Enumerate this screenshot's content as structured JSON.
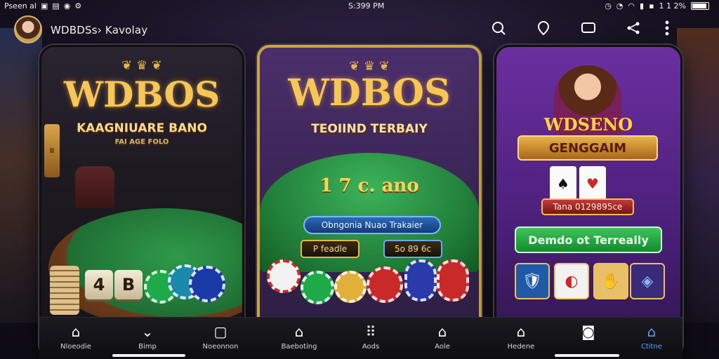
{
  "status_bar": {
    "left_text": "Pseen al",
    "time": "S:399 PM",
    "battery": "1 1 2%"
  },
  "app_bar": {
    "title": "WDBDSs› Kavolay"
  },
  "phone_1": {
    "brand": "WDBOS",
    "tagline": "KAAGNIUARE BANO",
    "subtag": "FAI AGE FOLO",
    "dice": [
      "4",
      "B"
    ]
  },
  "phone_2": {
    "brand": "WDBOS",
    "tagline": "TEOIIND TERBAIY",
    "odds": "1 7 c. ano",
    "banner": "Obngonia Nuao Trakaier",
    "pill_left": "P feadle",
    "pill_right": "5o 89 6c"
  },
  "phone_3": {
    "brand": "WDSENO",
    "banner": "GENGGAIM",
    "promo": "Tana 0129895ce",
    "cta": "Demdo ot Terreally"
  },
  "nav": {
    "items": [
      {
        "label": "Nloeodie",
        "icon": "home-icon"
      },
      {
        "label": "Bimp",
        "icon": "chevron-down-icon"
      },
      {
        "label": "Noeonnon",
        "icon": "frame-icon"
      },
      {
        "label": "Baeboting",
        "icon": "house-icon"
      },
      {
        "label": "Aods",
        "icon": "dots-icon"
      },
      {
        "label": "Aole",
        "icon": "shop-icon"
      },
      {
        "label": "Hedene",
        "icon": "home-icon"
      },
      {
        "label": "",
        "icon": "camera-icon"
      },
      {
        "label": "Ctitne",
        "icon": "store-icon"
      }
    ]
  },
  "colors": {
    "accent_gold": "#f6c65a",
    "accent_green": "#2f9a4a",
    "active_blue": "#4aa8ff"
  }
}
